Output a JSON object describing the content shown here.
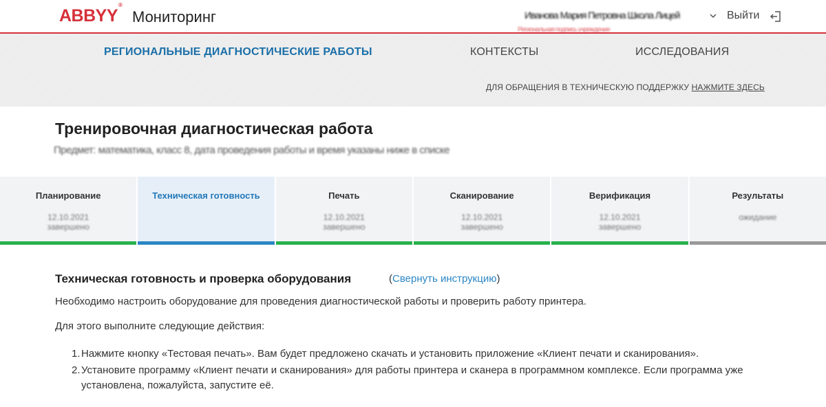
{
  "header": {
    "logo": "ABBYY",
    "logo_mark": "®",
    "app_title": "Мониторинг",
    "user_name": "Иванова Мария Петровна Школа Лицей",
    "user_name_second": "Региональная подпись учреждения",
    "logout_label": "Выйти",
    "accent_color": "#d6303a"
  },
  "nav": {
    "items": [
      {
        "label": "РЕГИОНАЛЬНЫЕ ДИАГНОСТИЧЕСКИЕ РАБОТЫ",
        "active": true
      },
      {
        "label": "КОНТЕКСТЫ",
        "active": false
      },
      {
        "label": "ИССЛЕДОВАНИЯ",
        "active": false
      }
    ],
    "support_text": "ДЛЯ ОБРАЩЕНИЯ В ТЕХНИЧЕСКУЮ ПОДДЕРЖКУ",
    "support_link": "НАЖМИТЕ ЗДЕСЬ",
    "active_color": "#1a6fa8"
  },
  "page": {
    "title": "Тренировочная диагностическая работа",
    "subtitle": "Предмет: математика, класс 8, дата проведения работы и время указаны ниже в списке"
  },
  "steps": [
    {
      "label": "Планирование",
      "date": "12.10.2021\nзавершено",
      "state": "done"
    },
    {
      "label": "Техническая готовность",
      "date": "",
      "state": "active"
    },
    {
      "label": "Печать",
      "date": "12.10.2021\nзавершено",
      "state": "done"
    },
    {
      "label": "Сканирование",
      "date": "12.10.2021\nзавершено",
      "state": "done"
    },
    {
      "label": "Верификация",
      "date": "12.10.2021\nзавершено",
      "state": "done"
    },
    {
      "label": "Результаты",
      "date": "ожидание",
      "state": "pending"
    }
  ],
  "content": {
    "heading": "Техническая готовность и проверка оборудования",
    "collapse_open": "(",
    "collapse_link": "Свернуть инструкцию",
    "collapse_close": ")",
    "intro": "Необходимо настроить оборудование для проведения диагностической работы и проверить работу принтера.",
    "lead": "Для этого выполните следующие действия:",
    "list": [
      {
        "num": "1.",
        "text": "Нажмите кнопку «Тестовая печать». Вам будет предложено скачать и установить приложение «Клиент печати и сканирования»."
      },
      {
        "num": "2.",
        "text": "Установите программу «Клиент печати и сканирования» для работы принтера и сканера в программном комплексе. Если программа уже установлена, пожалуйста, запустите её."
      }
    ]
  }
}
